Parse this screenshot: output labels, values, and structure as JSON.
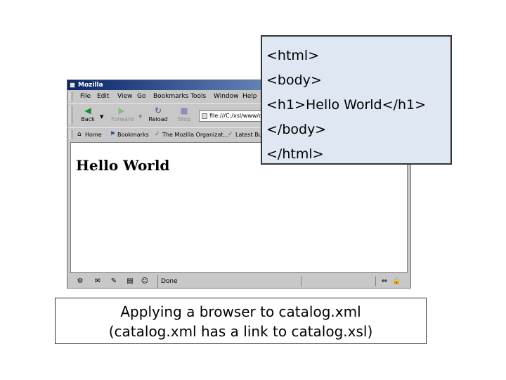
{
  "window": {
    "title": "Mozilla"
  },
  "menu": [
    "File",
    "Edit",
    "View",
    "Go",
    "Bookmarks",
    "Tools",
    "Window",
    "Help"
  ],
  "toolbar": {
    "back": "Back",
    "forward": "Forward",
    "reload": "Reload",
    "stop": "Stop"
  },
  "address": {
    "value": "file:///C:/xsl/www/catalog.xml"
  },
  "personal_toolbar": [
    "Home",
    "Bookmarks",
    "The Mozilla Organizat...",
    "Latest Bu"
  ],
  "page": {
    "heading": "Hello World"
  },
  "status": {
    "text": "Done"
  },
  "code": [
    "<html>",
    "<body>",
    "<h1>Hello World</h1>",
    "</body>",
    "</html>"
  ],
  "caption": {
    "line1": "Applying a browser to catalog.xml",
    "line2": "(catalog.xml has a link to catalog.xsl)"
  },
  "colors": {
    "code_box_bg": "#dfe7f2",
    "titlebar": "#0a246a"
  }
}
